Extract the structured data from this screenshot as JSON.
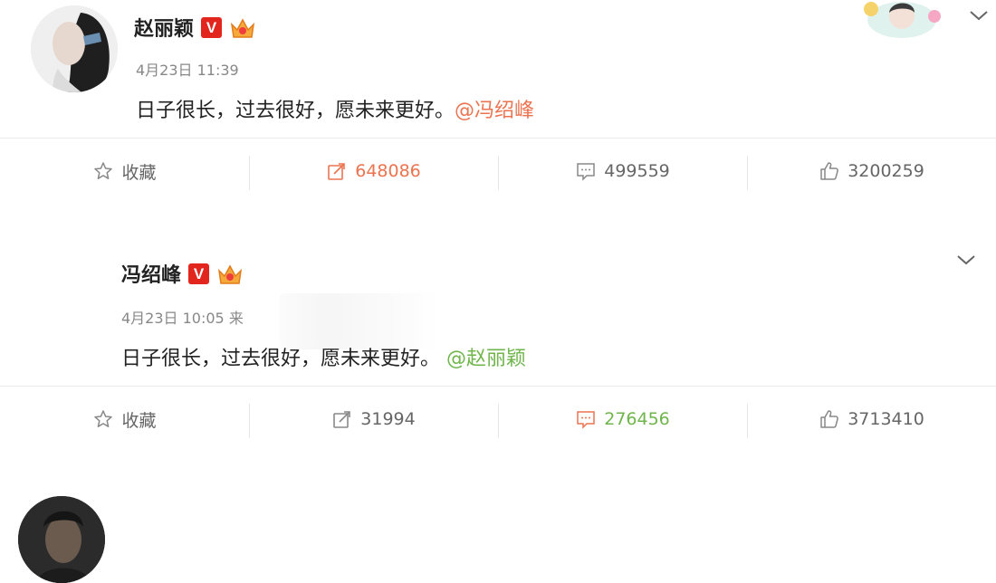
{
  "posts": [
    {
      "author": "赵丽颖",
      "verified_badge": "V",
      "timestamp": "4月23日 11:39",
      "text": "日子很长，过去很好，愿未来更好。",
      "mention": "@冯绍峰",
      "actions": {
        "favorite_label": "收藏",
        "repost_count": "648086",
        "comment_count": "499559",
        "like_count": "3200259"
      }
    },
    {
      "author": "冯绍峰",
      "verified_badge": "V",
      "timestamp": "4月23日 10:05 来",
      "text": "日子很长，过去很好，愿未来更好。",
      "mention": "@赵丽颖",
      "actions": {
        "favorite_label": "收藏",
        "repost_count": "31994",
        "comment_count": "276456",
        "like_count": "3713410"
      }
    }
  ],
  "colors": {
    "accent_orange": "#eb7350",
    "accent_green": "#6fb54c",
    "verified_red": "#e2251d"
  },
  "icons": [
    "star-icon",
    "repost-icon",
    "comment-icon",
    "like-icon",
    "chevron-down-icon",
    "crown-icon"
  ]
}
